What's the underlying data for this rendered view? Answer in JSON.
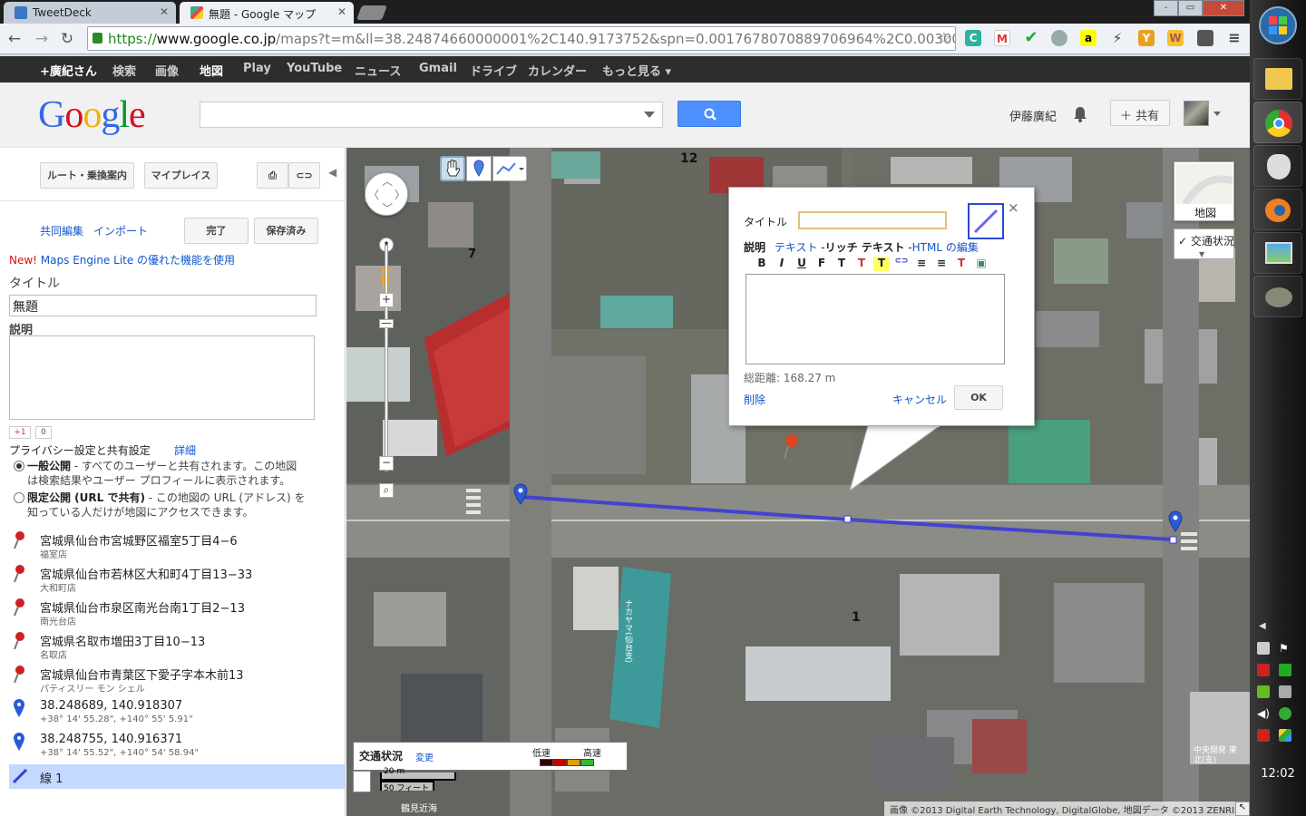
{
  "browser": {
    "tabs": [
      {
        "label": "TweetDeck",
        "icon": "tweetdeck-icon"
      },
      {
        "label": "無題 - Google マップ",
        "icon": "google-maps-icon"
      }
    ],
    "address": {
      "scheme": "https://",
      "host": "www.google.co.jp",
      "path": "/maps?t=m&ll=38.24874660000001%2C140.9173752&spn=0.0017678070889706964%2C0.00300"
    },
    "extensions": [
      "c-icon",
      "gmail-icon",
      "check-icon",
      "globe-icon",
      "amazon-icon",
      "bolt-icon",
      "fork-icon",
      "w-icon",
      "screenshot-icon",
      "menu-icon"
    ],
    "window_controls": [
      "-",
      "▭",
      "✕"
    ]
  },
  "gbar": {
    "items": [
      "+廣紀さん",
      "検索",
      "画像",
      "地図",
      "Play",
      "YouTube",
      "ニュース",
      "Gmail",
      "ドライブ",
      "カレンダー",
      "もっと見る ▾"
    ]
  },
  "header": {
    "logo": "Google",
    "search_value": "",
    "user_name": "伊藤廣紀",
    "share_label": "共有",
    "accent": "#4d90fe"
  },
  "left": {
    "route_btn": "ルート・乗換案内",
    "myplaces_btn": "マイプレイス",
    "collab_edit": "共同編集",
    "import": "インポート",
    "done_btn": "完了",
    "saved_btn": "保存済み",
    "promo_new": "New!",
    "promo_text": " Maps Engine Lite の優れた機能を使用",
    "title_label": "タイトル",
    "title_value": "無題",
    "desc_label": "説明",
    "desc_value": "",
    "plusone": "+1",
    "plusone_count": "0",
    "privacy_label": "プライバシー設定と共有設定",
    "privacy_detail": "詳細",
    "public_title": "一般公開",
    "public_desc_1": " - すべてのユーザーと共有されます。この地図",
    "public_desc_2": "は検索結果やユーザー プロフィールに表示されます。",
    "limited_title": "限定公開 (URL で共有)",
    "limited_desc_1": " - この地図の URL (アドレス) を",
    "limited_desc_2": "知っている人だけが地図にアクセスできます。",
    "places": [
      {
        "title": "宮城県仙台市宮城野区福室5丁目4−6",
        "sub": "福室店",
        "kind": "red"
      },
      {
        "title": "宮城県仙台市若林区大和町4丁目13−33",
        "sub": "大和町店",
        "kind": "red"
      },
      {
        "title": "宮城県仙台市泉区南光台南1丁目2−13",
        "sub": "南光台店",
        "kind": "red"
      },
      {
        "title": "宮城県名取市増田3丁目10−13",
        "sub": "名取店",
        "kind": "red"
      },
      {
        "title": "宮城県仙台市青葉区下愛子字本木前13",
        "sub": "パティスリー モン シェル",
        "kind": "red"
      },
      {
        "title": "38.248689, 140.918307",
        "sub": "+38° 14' 55.28\", +140° 55' 5.91\"",
        "kind": "blue"
      },
      {
        "title": "38.248755, 140.916371",
        "sub": "+38° 14' 55.52\", +140° 54' 58.94\"",
        "kind": "blue"
      }
    ],
    "line_item": "線 1"
  },
  "map": {
    "maptype_label": "地図",
    "traffic_label": "交通状況",
    "traffic_legend_title": "交通状況",
    "traffic_legend_change": "変更",
    "traffic_slow": "低速",
    "traffic_fast": "高速",
    "scale_metric": "20 m",
    "scale_imperial": "50 フィート",
    "copyright": "画像 ©2013 Digital Earth Technology, DigitalGlobe, 地図データ ©2013 ZENRIN -",
    "label_12": "12",
    "label_7": "7",
    "label_1": "1",
    "bottom_left_label": "鶴見近海",
    "building_label": "中央開発 東北(支)",
    "vertical_sign": "ナカヤマ(仙台支)",
    "route_color": "#3b3bd6"
  },
  "infowindow": {
    "title_label": "タイトル",
    "title_value": "",
    "desc_label": "説明",
    "mode_plain": "テキスト",
    "mode_rich": "リッチ テキスト",
    "mode_html": "HTML の編集",
    "distance": "総距離: 168.27 m",
    "delete": "削除",
    "cancel": "キャンセル",
    "ok": "OK",
    "toolbar": [
      "B",
      "I",
      "U",
      "F",
      "T",
      "T",
      "T",
      "⊂⊃",
      "≡",
      "≡",
      "T",
      "▣"
    ]
  },
  "taskbar": {
    "clock": "12:02",
    "apps": [
      "explorer-icon",
      "chrome-icon",
      "gimp-fox-icon",
      "blender-icon",
      "image-viewer-icon",
      "gimp-icon"
    ]
  }
}
